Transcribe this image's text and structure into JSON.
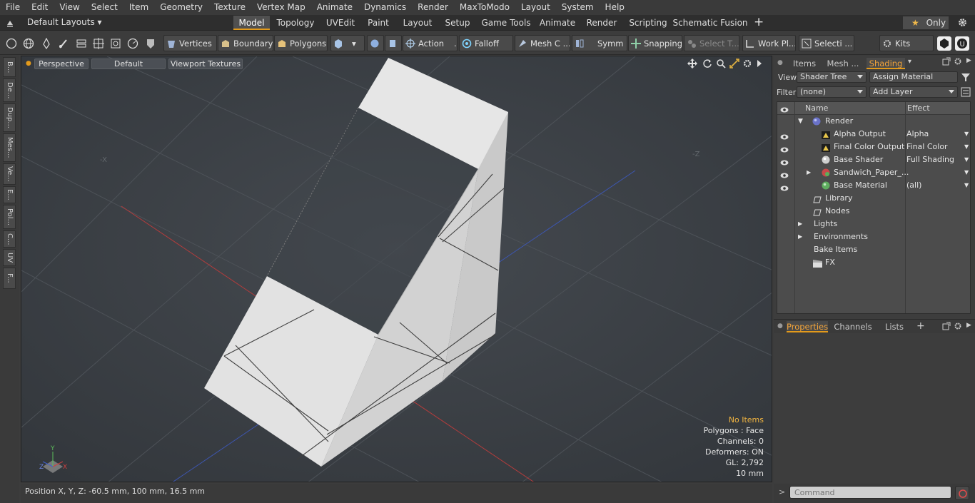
{
  "menu": [
    "File",
    "Edit",
    "View",
    "Select",
    "Item",
    "Geometry",
    "Texture",
    "Vertex Map",
    "Animate",
    "Dynamics",
    "Render",
    "MaxToModo",
    "Layout",
    "System",
    "Help"
  ],
  "layout_bar": {
    "layouts_label": "Default Layouts",
    "tabs": [
      "Model",
      "Topology",
      "UVEdit",
      "Paint",
      "Layout",
      "Setup",
      "Game Tools",
      "Animate",
      "Render",
      "Scripting",
      "Schematic Fusion"
    ],
    "active_tab": "Model",
    "add_tab": "+",
    "only_label": "Only"
  },
  "toolbar": {
    "vertices": "Vertices",
    "boundary": "Boundary",
    "polygons": "Polygons",
    "action": "Action",
    "action_more": "...",
    "falloff": "Falloff",
    "mesh": "Mesh C ...",
    "symm": "Symm ...",
    "snapping": "Snapping",
    "select_t": "Select T...",
    "work_pl": "Work Pl...",
    "selecti": "Selecti ...",
    "kits": "Kits"
  },
  "left_tabs": [
    "B...",
    "De...",
    "Dup...",
    "Mes...",
    "Ve...",
    "E...",
    "Pol...",
    "C...",
    "UV",
    "F..."
  ],
  "viewport": {
    "perspective": "Perspective",
    "default": "Default",
    "textures": "Viewport Textures",
    "axis_x_neg": "-X",
    "axis_z_neg": "-Z",
    "stats": {
      "items": "No Items",
      "polygons": "Polygons : Face",
      "channels": "Channels: 0",
      "deformers": "Deformers: ON",
      "gl": "GL: 2,792",
      "scale": "10 mm"
    },
    "gizmo": {
      "y": "Y",
      "x": "X",
      "z": "Z"
    }
  },
  "status": {
    "position": "Position X, Y, Z:  -60.5 mm, 100 mm, 16.5 mm"
  },
  "right_panel": {
    "tabs": [
      "Items",
      "Mesh ...",
      "Shading"
    ],
    "active_tab": "Shading",
    "view_label": "View",
    "view_value": "Shader Tree",
    "assign_material": "Assign Material",
    "filter_label": "Filter",
    "filter_value": "(none)",
    "add_layer": "Add Layer",
    "columns": {
      "name": "Name",
      "effect": "Effect"
    },
    "rows": [
      {
        "name": "Render",
        "effect": ""
      },
      {
        "name": "Alpha Output",
        "effect": "Alpha"
      },
      {
        "name": "Final Color Output",
        "effect": "Final Color"
      },
      {
        "name": "Base Shader",
        "effect": "Full Shading"
      },
      {
        "name": "Sandwich_Paper_...",
        "effect": ""
      },
      {
        "name": "Base Material",
        "effect": "(all)"
      },
      {
        "name": "Library",
        "effect": ""
      },
      {
        "name": "Nodes",
        "effect": ""
      },
      {
        "name": "Lights",
        "effect": ""
      },
      {
        "name": "Environments",
        "effect": ""
      },
      {
        "name": "Bake Items",
        "effect": ""
      },
      {
        "name": "FX",
        "effect": ""
      }
    ],
    "bottom_tabs": [
      "Properties",
      "Channels",
      "Lists"
    ],
    "bottom_active": "Properties",
    "command_placeholder": "Command"
  },
  "colors": {
    "accent": "#e39a1b",
    "highlight_text": "#f2b540"
  }
}
